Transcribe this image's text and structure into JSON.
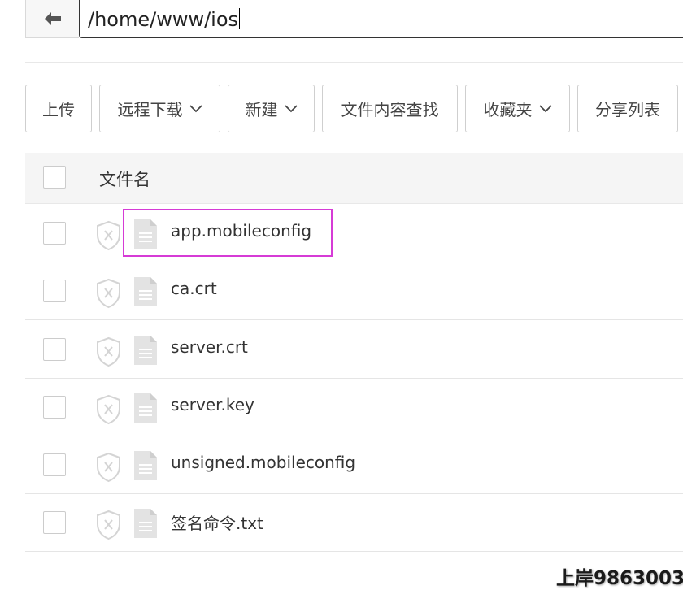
{
  "path_bar": {
    "back_icon": "arrow-left-icon",
    "path": "/home/www/ios"
  },
  "toolbar": {
    "buttons": [
      {
        "label": "上传",
        "has_dropdown": false
      },
      {
        "label": "远程下载",
        "has_dropdown": true
      },
      {
        "label": "新建",
        "has_dropdown": true
      },
      {
        "label": "文件内容查找",
        "has_dropdown": false
      },
      {
        "label": "收藏夹",
        "has_dropdown": true
      },
      {
        "label": "分享列表",
        "has_dropdown": false
      }
    ]
  },
  "table": {
    "header": {
      "name_col": "文件名"
    },
    "rows": [
      {
        "name": "app.mobileconfig",
        "icon": "file-icon",
        "status_icon": "shield-x-icon",
        "highlighted": true
      },
      {
        "name": "ca.crt",
        "icon": "file-icon",
        "status_icon": "shield-x-icon",
        "highlighted": false
      },
      {
        "name": "server.crt",
        "icon": "file-icon",
        "status_icon": "shield-x-icon",
        "highlighted": false
      },
      {
        "name": "server.key",
        "icon": "file-icon",
        "status_icon": "shield-x-icon",
        "highlighted": false
      },
      {
        "name": "unsigned.mobileconfig",
        "icon": "file-icon",
        "status_icon": "shield-x-icon",
        "highlighted": false
      },
      {
        "name": "签名命令.txt",
        "icon": "file-icon",
        "status_icon": "shield-x-icon",
        "highlighted": false
      }
    ]
  },
  "colors": {
    "highlight": "#d63bd6",
    "header_bg": "#f5f5f5",
    "icon_gray": "#d0d0d0"
  },
  "watermark": "上岸9863003"
}
